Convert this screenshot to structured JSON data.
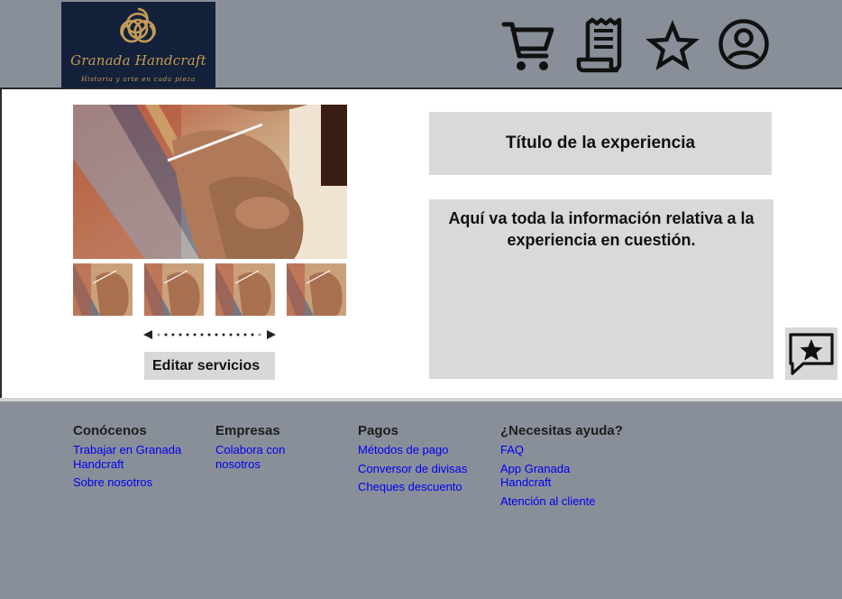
{
  "header": {
    "logo": {
      "brand": "Granada Handcraft",
      "tagline": "Historia y arte en cada pieza"
    },
    "icons": [
      "cart-icon",
      "receipt-icon",
      "star-icon",
      "user-icon"
    ]
  },
  "gallery": {
    "thumbnail_count": 4,
    "edit_button_label": "Editar servicios"
  },
  "experience": {
    "title": "Título de la experiencia",
    "description": "Aquí va toda la información relativa a la experiencia en cuestión."
  },
  "footer": {
    "columns": [
      {
        "heading": "Conócenos",
        "links": [
          "Trabajar en Granada Handcraft",
          "Sobre nosotros"
        ]
      },
      {
        "heading": "Empresas",
        "links": [
          "Colabora con nosotros"
        ]
      },
      {
        "heading": "Pagos",
        "links": [
          "Métodos de pago",
          "Conversor de divisas",
          "Cheques descuento"
        ]
      },
      {
        "heading": "¿Necesitas ayuda?",
        "links": [
          "FAQ",
          "App Granada Handcraft",
          "Atención al cliente"
        ]
      }
    ]
  },
  "colors": {
    "header_bg": "#898f99",
    "logo_bg": "#13213a",
    "logo_gold": "#c49a55",
    "panel_gray": "#d9d9d9",
    "link_blue": "#0000ee"
  }
}
